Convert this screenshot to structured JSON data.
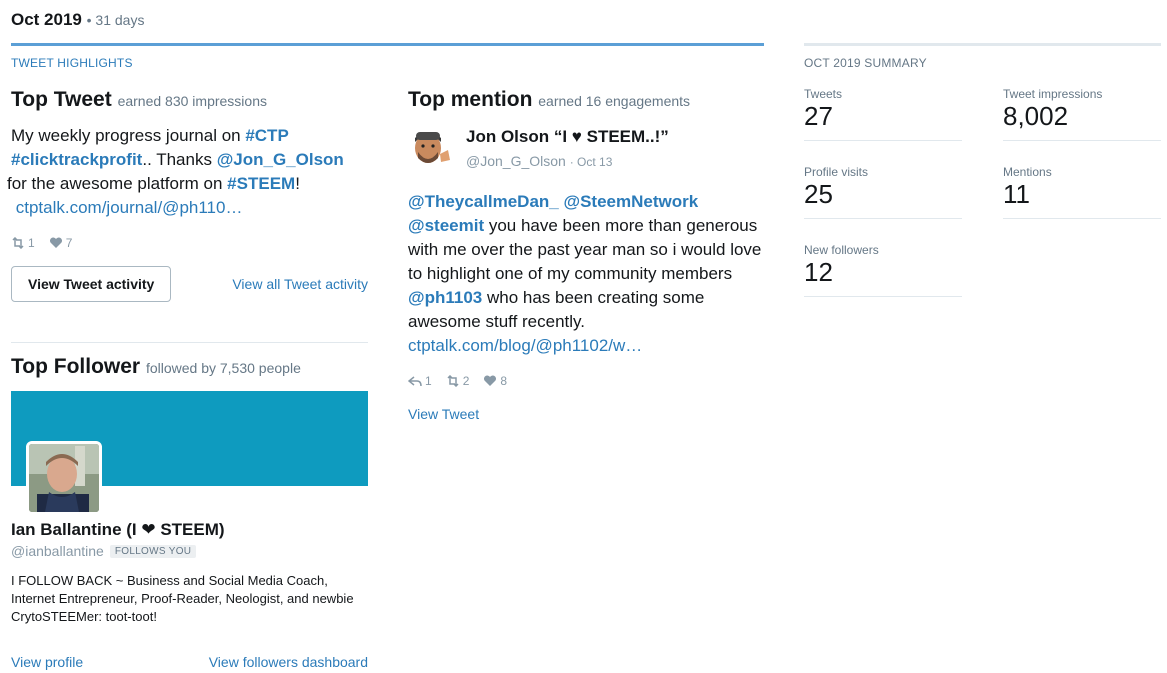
{
  "header": {
    "month": "Oct 2019",
    "days": "• 31 days"
  },
  "highlights": {
    "label": "TWEET HIGHLIGHTS",
    "top_tweet": {
      "title": "Top Tweet",
      "subtitle": "earned 830 impressions",
      "text_1": "My weekly progress journal on ",
      "tag_1": "#CTP",
      "tag_2": "#clicktrackprofit",
      "text_2": ".. Thanks ",
      "mention_1": "@Jon_G_Olson",
      "text_3": " for the awesome platform on ",
      "tag_3": "#STEEM",
      "text_4": "!",
      "url": "ctptalk.com/journal/@ph110…",
      "retweets": "1",
      "likes": "7",
      "button": "View Tweet activity",
      "link": "View all Tweet activity"
    },
    "top_follower": {
      "title": "Top Follower",
      "subtitle": "followed by 7,530 people",
      "name": "Ian Ballantine (I ❤ STEEM)",
      "handle": "@ianballantine",
      "badge": "FOLLOWS YOU",
      "bio": "I FOLLOW BACK ~ Business and Social Media Coach, Internet Entrepreneur, Proof-Reader, Neologist, and newbie CrytoSTEEMer: toot-toot!",
      "link_profile": "View profile",
      "link_dashboard": "View followers dashboard"
    },
    "top_mention": {
      "title": "Top mention",
      "subtitle": "earned 16 engagements",
      "name": "Jon Olson “I ♥ STEEM..!”",
      "handle": "@Jon_G_Olson",
      "date": "· Oct 13",
      "m1": "@TheycallmeDan_",
      "m2": "@SteemNetwork",
      "m3": "@steemit",
      "text_1": " you have been more than generous with me over the past year man so i would love to highlight one of my community members ",
      "m4": "@ph1103",
      "text_2": " who has been creating some awesome stuff recently.",
      "url": "ctptalk.com/blog/@ph1102/w…",
      "replies": "1",
      "retweets": "2",
      "likes": "8",
      "link": "View Tweet"
    }
  },
  "summary": {
    "label": "OCT 2019 SUMMARY",
    "tweets_label": "Tweets",
    "tweets": "27",
    "impressions_label": "Tweet impressions",
    "impressions": "8,002",
    "visits_label": "Profile visits",
    "visits": "25",
    "mentions_label": "Mentions",
    "mentions": "11",
    "followers_label": "New followers",
    "followers": "12"
  },
  "colors": {
    "accent": "#2b7bb9",
    "banner": "#0e9bbf",
    "rule": "#5b9fd6"
  }
}
